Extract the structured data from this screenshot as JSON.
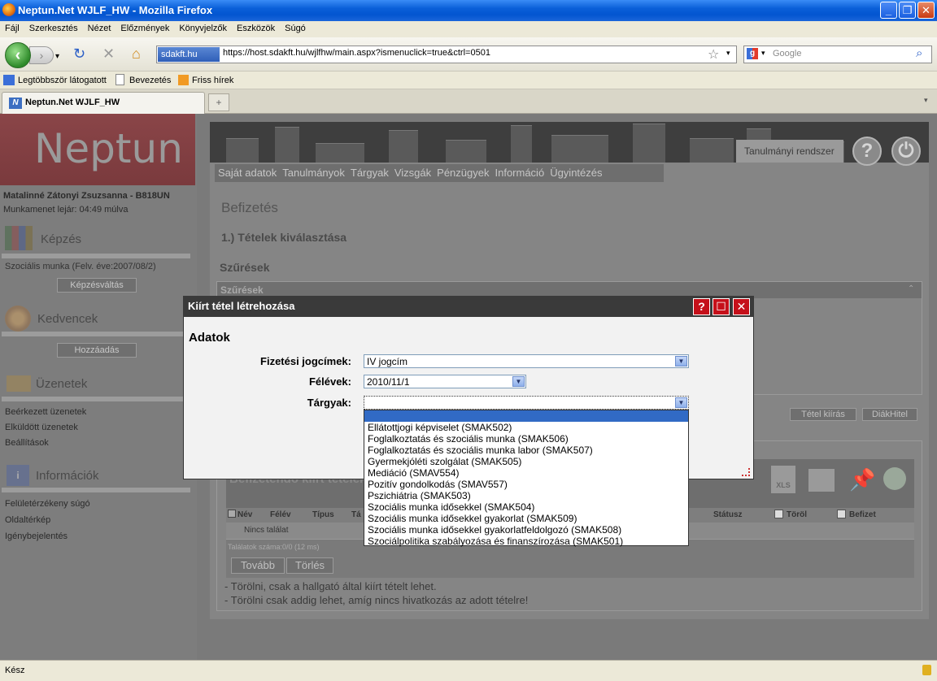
{
  "window": {
    "title": "Neptun.Net WJLF_HW - Mozilla Firefox"
  },
  "menubar": [
    "Fájl",
    "Szerkesztés",
    "Nézet",
    "Előzmények",
    "Könyvjelzők",
    "Eszközök",
    "Súgó"
  ],
  "nav": {
    "badge": "sdakft.hu",
    "url": "https://host.sdakft.hu/wjlfhw/main.aspx?ismenuclick=true&ctrl=0501",
    "search_placeholder": "Google"
  },
  "bookmarks": [
    "Legtöbbször látogatott",
    "Bevezetés",
    "Friss hírek"
  ],
  "tab": {
    "title": "Neptun.Net WJLF_HW"
  },
  "sidebar": {
    "logo": "Neptun",
    "user": "Matalinné Zátonyi Zsuzsanna - B818UN",
    "session": "Munkamenet lejár: 04:49 múlva",
    "kepzes_head": "Képzés",
    "kepzes_item": "Szociális munka (Felv. éve:2007/08/2)",
    "kepzes_btn": "Képzésváltás",
    "kedvencek_head": "Kedvencek",
    "kedvencek_btn": "Hozzáadás",
    "uzenetek_head": "Üzenetek",
    "uzenetek_items": [
      "Beérkezett üzenetek",
      "Elküldött üzenetek",
      "Beállítások"
    ],
    "info_head": "Információk",
    "info_items": [
      "Felületérzékeny súgó",
      "Oldaltérkép",
      "Igénybejelentés"
    ]
  },
  "header": {
    "system_tab": "Tanulmányi rendszer"
  },
  "mainmenu": [
    "Saját adatok",
    "Tanulmányok",
    "Tárgyak",
    "Vizsgák",
    "Pénzügyek",
    "Információ",
    "Ügyintézés"
  ],
  "page": {
    "title": "Befizetés",
    "step": "1.) Tételek kiválasztása",
    "filters_title": "Szűrések",
    "filters_panel": "Szűrések",
    "btn_tetel": "Tétel kiírás",
    "btn_diak": "DiákHitel",
    "grid_title": "Befizetendő kiírt tételek",
    "grid_cols": [
      "Név",
      "Félév",
      "Típus",
      "Tá",
      "Státusz",
      "Töröl",
      "Befizet"
    ],
    "grid_empty": "Nincs találat",
    "grid_count": "Találatok száma:0/0 (12 ms)",
    "btn_tovabb": "Tovább",
    "btn_torles": "Törlés",
    "note1": "- Törölni, csak a hallgató által kiírt tételt lehet.",
    "note2": "- Törölni csak addig lehet, amíg nincs hivatkozás az adott tételre!"
  },
  "dialog": {
    "title": "Kiírt tétel létrehozása",
    "section": "Adatok",
    "label_jogcim": "Fizetési jogcímek:",
    "value_jogcim": "IV jogcím",
    "label_felev": "Félévek:",
    "value_felev": "2010/11/1",
    "label_targy": "Tárgyak:",
    "value_targy": "",
    "options": [
      "",
      "Ellátottjogi képviselet (SMAK502)",
      "Foglalkoztatás és szociális munka (SMAK506)",
      "Foglalkoztatás és szociális munka labor (SMAK507)",
      "Gyermekjóléti szolgálat (SMAK505)",
      "Mediáció (SMAV554)",
      "Pozitív gondolkodás (SMAV557)",
      "Pszichiátria (SMAK503)",
      "Szociális munka idősekkel (SMAK504)",
      "Szociális munka idősekkel gyakorlat (SMAK509)",
      "Szociális munka idősekkel gyakorlatfeldolgozó (SMAK508)",
      "Szociálpolitika szabályozása és finanszírozása (SMAK501)"
    ]
  },
  "status": {
    "text": "Kész"
  }
}
